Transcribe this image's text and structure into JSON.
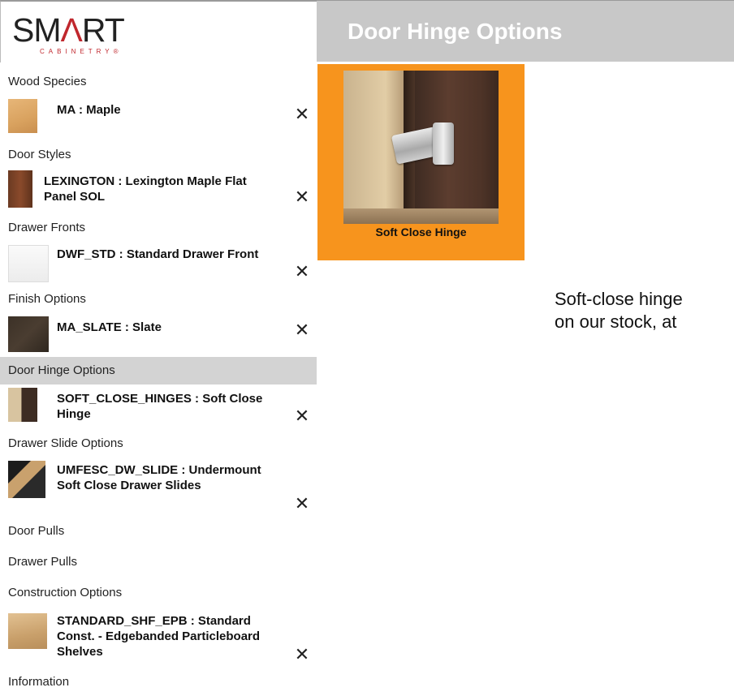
{
  "header": {
    "logo_main_pre": "SM",
    "logo_main_accent": "Λ",
    "logo_main_post": "RT",
    "logo_sub": "CABINETRY®",
    "title": "Door Hinge Options"
  },
  "sidebar": {
    "categories": [
      {
        "label": "Wood Species"
      },
      {
        "label": "Door Styles"
      },
      {
        "label": "Drawer Fronts"
      },
      {
        "label": "Finish Options"
      },
      {
        "label": "Door Hinge Options",
        "active": true
      },
      {
        "label": "Drawer Slide Options"
      },
      {
        "label": "Door Pulls"
      },
      {
        "label": "Drawer Pulls"
      },
      {
        "label": "Construction Options"
      },
      {
        "label": "Information"
      }
    ],
    "selections": [
      {
        "label": "MA : Maple",
        "thumb": "maple-swatch"
      },
      {
        "label": "LEXINGTON : Lexington Maple Flat Panel SOL",
        "thumb": "lexington-door"
      },
      {
        "label": "DWF_STD : Standard Drawer Front",
        "thumb": "drawer-front"
      },
      {
        "label": "MA_SLATE : Slate",
        "thumb": "slate-swatch"
      },
      {
        "label": "SOFT_CLOSE_HINGES : Soft Close Hinge",
        "thumb": "hinge"
      },
      {
        "label": "UMFESC_DW_SLIDE : Undermount Soft Close Drawer Slides",
        "thumb": "drawer-slide"
      },
      {
        "label": "STANDARD_SHF_EPB : Standard Const. - Edgebanded Particleboard Shelves",
        "thumb": "shelf"
      }
    ],
    "remove_icon": "✕"
  },
  "main": {
    "card_label": "Soft Close Hinge",
    "card_color": "#f7941d",
    "description_line1": "Soft-close hinge",
    "description_line2": "on our stock, at"
  }
}
